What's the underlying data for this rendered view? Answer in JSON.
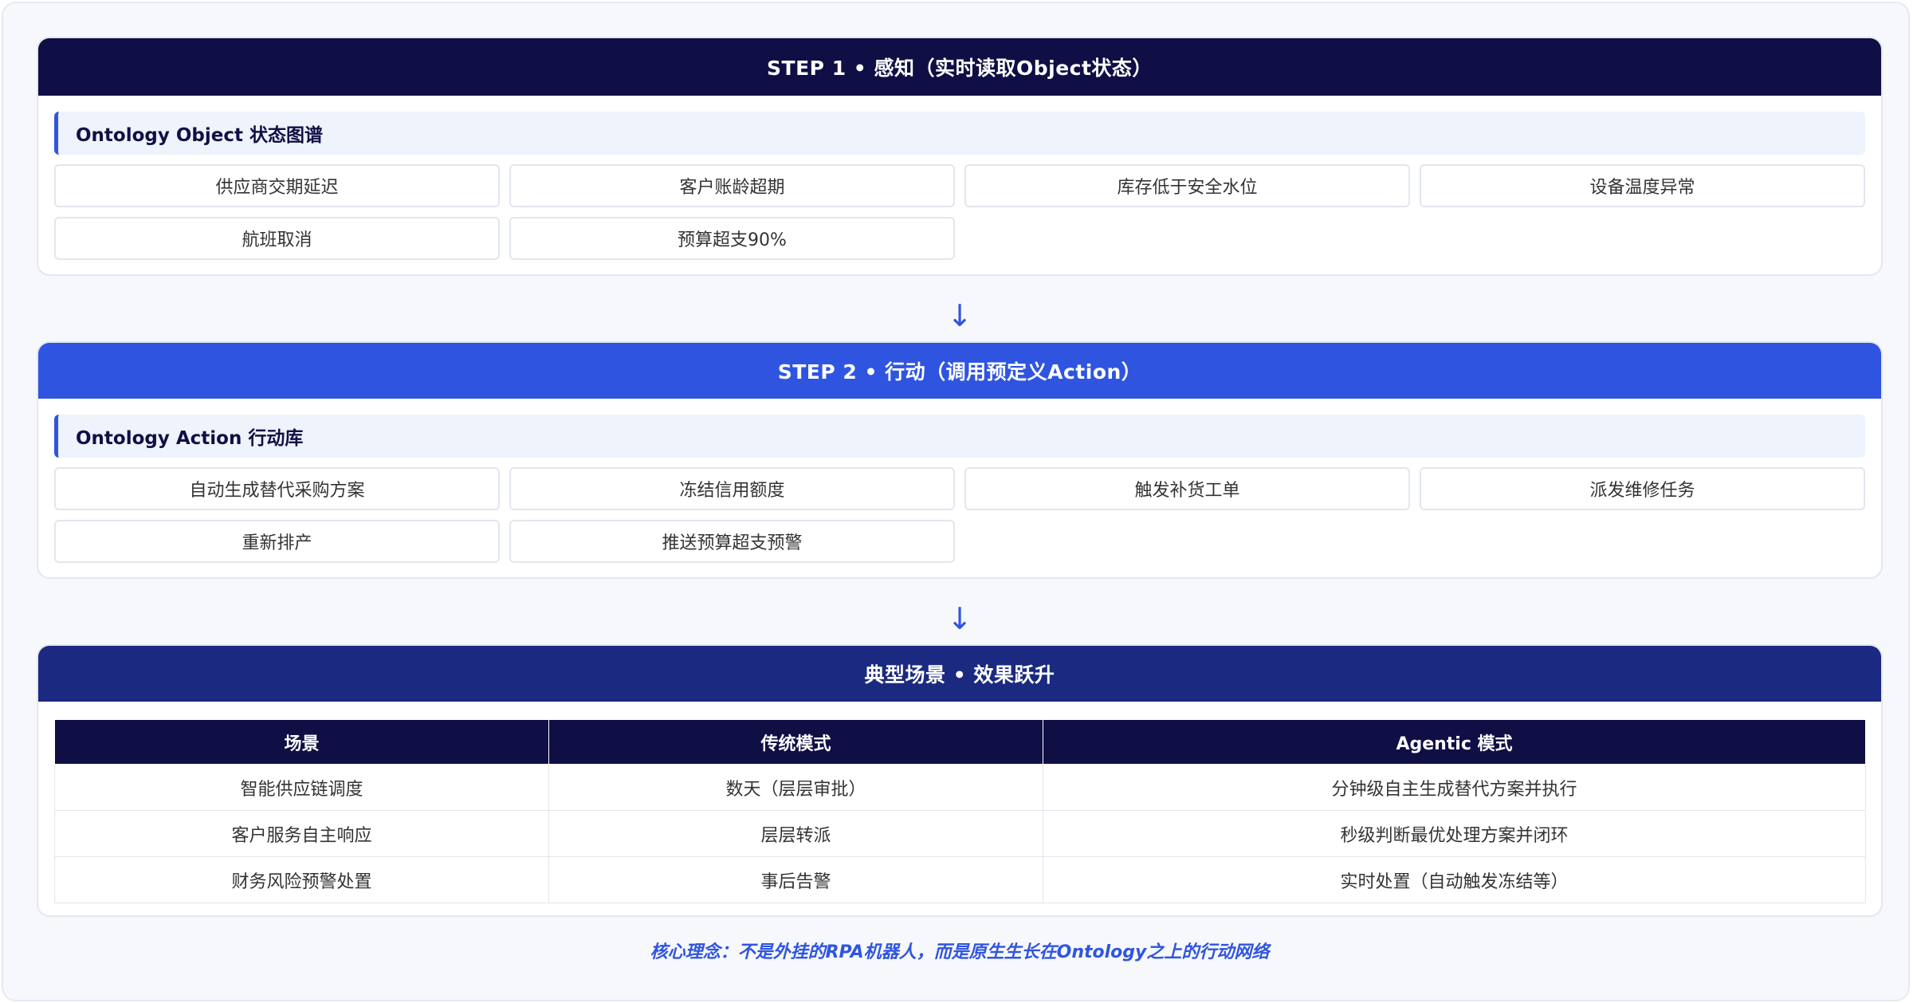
{
  "colors": {
    "header_navy": "#0f0f45",
    "header_blue": "#2f55e0",
    "header_indigo": "#1b2a80",
    "accent": "#2f55e0",
    "subhead_bg": "#eef3fc"
  },
  "step1": {
    "title": "STEP 1 • 感知（实时读取Object状态）",
    "subhead": "Ontology Object 状态图谱",
    "items": [
      "供应商交期延迟",
      "客户账龄超期",
      "库存低于安全水位",
      "设备温度异常",
      "航班取消",
      "预算超支90%"
    ]
  },
  "arrow1": "↓",
  "step2": {
    "title": "STEP 2 • 行动（调用预定义Action）",
    "subhead": "Ontology Action 行动库",
    "items": [
      "自动生成替代采购方案",
      "冻结信用额度",
      "触发补货工单",
      "派发维修任务",
      "重新排产",
      "推送预算超支预警"
    ]
  },
  "arrow2": "↓",
  "scenarios": {
    "title": "典型场景 • 效果跃升",
    "headers": [
      "场景",
      "传统模式",
      "Agentic 模式"
    ],
    "rows": [
      [
        "智能供应链调度",
        "数天（层层审批）",
        "分钟级自主生成替代方案并执行"
      ],
      [
        "客户服务自主响应",
        "层层转派",
        "秒级判断最优处理方案并闭环"
      ],
      [
        "财务风险预警处置",
        "事后告警",
        "实时处置（自动触发冻结等）"
      ]
    ]
  },
  "footer_note": "核心理念：不是外挂的RPA机器人，而是原生生长在Ontology之上的行动网络"
}
